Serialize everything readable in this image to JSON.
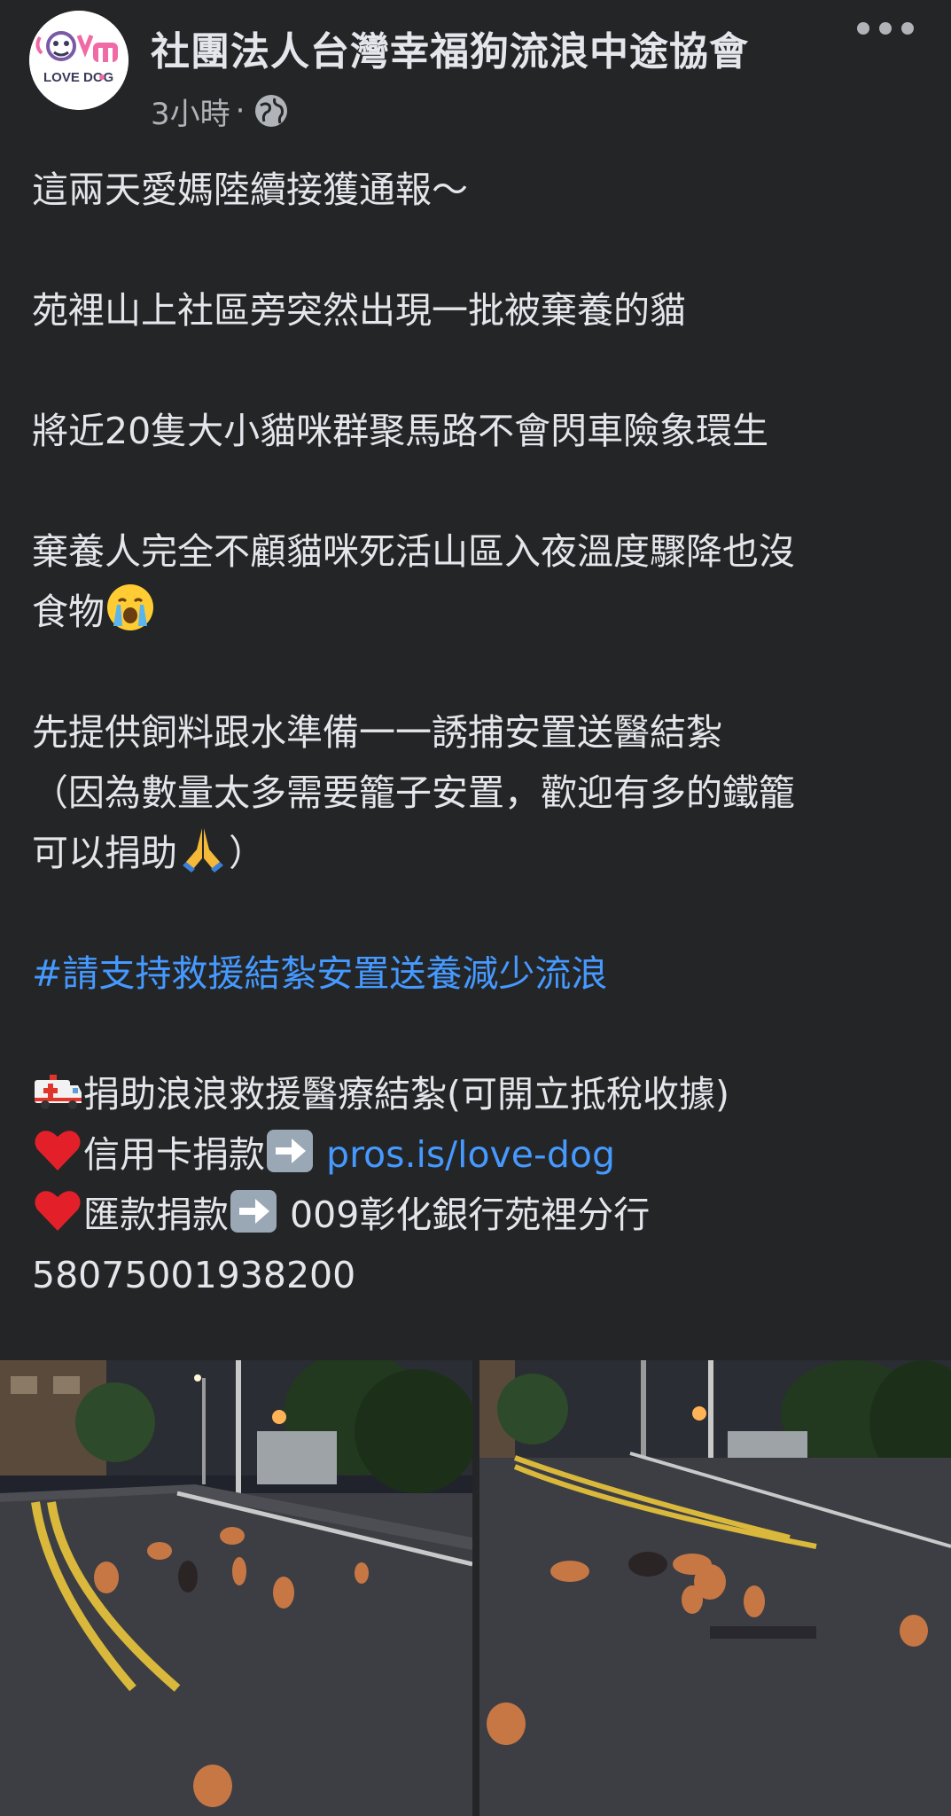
{
  "post": {
    "page_name": "社團法人台灣幸福狗流浪中途協會",
    "timestamp": "3小時",
    "separator": "·",
    "avatar_text": "LOVE DOG",
    "privacy_icon": "globe-icon",
    "more_icon": "more-options-icon"
  },
  "content": {
    "line1": "這兩天愛媽陸續接獲通報～",
    "line2": "苑裡山上社區旁突然出現一批被棄養的貓",
    "line3": "將近20隻大小貓咪群聚馬路不會閃車險象環生",
    "line4a": "棄養人完全不顧貓咪死活山區入夜溫度驟降也沒",
    "line4b": "食物",
    "line5": "先提供飼料跟水準備一一誘捕安置送醫結紮",
    "line6": "（因為數量太多需要籠子安置，歡迎有多的鐵籠",
    "line7": "可以捐助",
    "line7_end": "）",
    "hashtag": "#請支持救援結紮安置送養減少流浪",
    "donate_title": "捐助浪浪救援醫療結紮(可開立抵稅收據)",
    "credit_label": "信用卡捐款",
    "credit_link": "pros.is/love-dog",
    "transfer_label": "匯款捐款",
    "transfer_bank": " 009彰化銀行苑裡分行",
    "account_number": "58075001938200"
  },
  "icons": {
    "crying": "crying-face-icon",
    "pray": "folded-hands-icon",
    "ambulance": "ambulance-icon",
    "heart": "red-heart-icon",
    "arrow": "right-arrow-icon"
  },
  "colors": {
    "background": "#242526",
    "text": "#e4e6eb",
    "secondary": "#b0b3b8",
    "link": "#4599ff"
  },
  "photos": {
    "count": 2
  }
}
